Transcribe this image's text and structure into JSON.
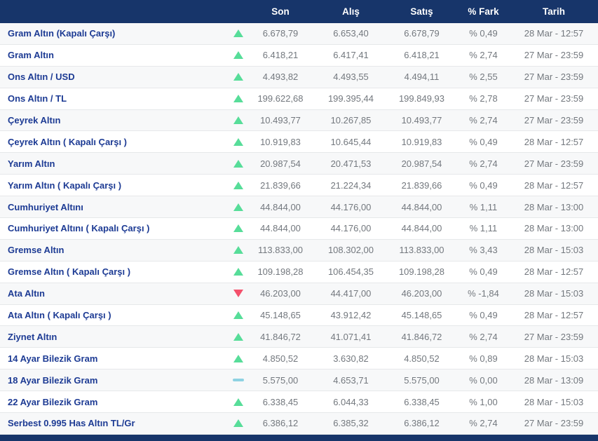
{
  "header": {
    "columns": [
      "Son",
      "Alış",
      "Satış",
      "% Fark",
      "Tarih"
    ]
  },
  "rows": [
    {
      "name": "Gram Altın (Kapalı Çarşı)",
      "trend": "up",
      "son": "6.678,79",
      "alis": "6.653,40",
      "satis": "6.678,79",
      "fark": "% 0,49",
      "tarih": "28 Mar - 12:57"
    },
    {
      "name": "Gram Altın",
      "trend": "up",
      "son": "6.418,21",
      "alis": "6.417,41",
      "satis": "6.418,21",
      "fark": "% 2,74",
      "tarih": "27 Mar - 23:59"
    },
    {
      "name": "Ons Altın / USD",
      "trend": "up",
      "son": "4.493,82",
      "alis": "4.493,55",
      "satis": "4.494,11",
      "fark": "% 2,55",
      "tarih": "27 Mar - 23:59"
    },
    {
      "name": "Ons Altın / TL",
      "trend": "up",
      "son": "199.622,68",
      "alis": "199.395,44",
      "satis": "199.849,93",
      "fark": "% 2,78",
      "tarih": "27 Mar - 23:59"
    },
    {
      "name": "Çeyrek Altın",
      "trend": "up",
      "son": "10.493,77",
      "alis": "10.267,85",
      "satis": "10.493,77",
      "fark": "% 2,74",
      "tarih": "27 Mar - 23:59"
    },
    {
      "name": "Çeyrek Altın ( Kapalı Çarşı )",
      "trend": "up",
      "son": "10.919,83",
      "alis": "10.645,44",
      "satis": "10.919,83",
      "fark": "% 0,49",
      "tarih": "28 Mar - 12:57"
    },
    {
      "name": "Yarım Altın",
      "trend": "up",
      "son": "20.987,54",
      "alis": "20.471,53",
      "satis": "20.987,54",
      "fark": "% 2,74",
      "tarih": "27 Mar - 23:59"
    },
    {
      "name": "Yarım Altın ( Kapalı Çarşı )",
      "trend": "up",
      "son": "21.839,66",
      "alis": "21.224,34",
      "satis": "21.839,66",
      "fark": "% 0,49",
      "tarih": "28 Mar - 12:57"
    },
    {
      "name": "Cumhuriyet Altını",
      "trend": "up",
      "son": "44.844,00",
      "alis": "44.176,00",
      "satis": "44.844,00",
      "fark": "% 1,11",
      "tarih": "28 Mar - 13:00"
    },
    {
      "name": "Cumhuriyet Altını ( Kapalı Çarşı )",
      "trend": "up",
      "son": "44.844,00",
      "alis": "44.176,00",
      "satis": "44.844,00",
      "fark": "% 1,11",
      "tarih": "28 Mar - 13:00"
    },
    {
      "name": "Gremse Altın",
      "trend": "up",
      "son": "113.833,00",
      "alis": "108.302,00",
      "satis": "113.833,00",
      "fark": "% 3,43",
      "tarih": "28 Mar - 15:03"
    },
    {
      "name": "Gremse Altın ( Kapalı Çarşı )",
      "trend": "up",
      "son": "109.198,28",
      "alis": "106.454,35",
      "satis": "109.198,28",
      "fark": "% 0,49",
      "tarih": "28 Mar - 12:57"
    },
    {
      "name": "Ata Altın",
      "trend": "down",
      "son": "46.203,00",
      "alis": "44.417,00",
      "satis": "46.203,00",
      "fark": "% -1,84",
      "tarih": "28 Mar - 15:03"
    },
    {
      "name": "Ata Altın ( Kapalı Çarşı )",
      "trend": "up",
      "son": "45.148,65",
      "alis": "43.912,42",
      "satis": "45.148,65",
      "fark": "% 0,49",
      "tarih": "28 Mar - 12:57"
    },
    {
      "name": "Ziynet Altın",
      "trend": "up",
      "son": "41.846,72",
      "alis": "41.071,41",
      "satis": "41.846,72",
      "fark": "% 2,74",
      "tarih": "27 Mar - 23:59"
    },
    {
      "name": "14 Ayar Bilezik Gram",
      "trend": "up",
      "son": "4.850,52",
      "alis": "3.630,82",
      "satis": "4.850,52",
      "fark": "% 0,89",
      "tarih": "28 Mar - 15:03"
    },
    {
      "name": "18 Ayar Bilezik Gram",
      "trend": "flat",
      "son": "5.575,00",
      "alis": "4.653,71",
      "satis": "5.575,00",
      "fark": "% 0,00",
      "tarih": "28 Mar - 13:09"
    },
    {
      "name": "22 Ayar Bilezik Gram",
      "trend": "up",
      "son": "6.338,45",
      "alis": "6.044,33",
      "satis": "6.338,45",
      "fark": "% 1,00",
      "tarih": "28 Mar - 15:03"
    },
    {
      "name": "Serbest 0.995 Has Altın TL/Gr",
      "trend": "up",
      "son": "6.386,12",
      "alis": "6.385,32",
      "satis": "6.386,12",
      "fark": "% 2,74",
      "tarih": "27 Mar - 23:59"
    }
  ],
  "colors": {
    "header_bg": "#17356a",
    "name_text": "#1d3b94",
    "value_text": "#73787e",
    "up": "#57dd99",
    "down": "#f4516c",
    "flat": "#8ed2e2",
    "stripe": "#f7f8f9"
  }
}
